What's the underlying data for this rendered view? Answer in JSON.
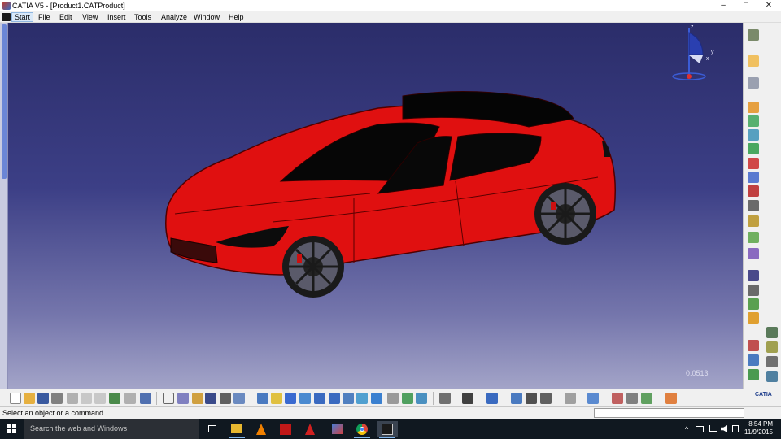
{
  "window": {
    "title": "CATIA V5 - [Product1.CATProduct]"
  },
  "window_controls": {
    "minimize": "–",
    "maximize": "□",
    "close": "✕"
  },
  "menu": {
    "items": [
      "Start",
      "File",
      "Edit",
      "View",
      "Insert",
      "Tools",
      "Analyze",
      "Window",
      "Help"
    ],
    "active": "Start"
  },
  "viewport": {
    "scale_readout": "0.0513",
    "compass_axes": {
      "z": "z",
      "x": "x",
      "y": "y"
    },
    "model_color": "#e01010"
  },
  "status": {
    "message": "Select an object or a command",
    "command_value": ""
  },
  "taskbar": {
    "search_placeholder": "Search the web and Windows",
    "apps": [
      "task-view",
      "file-explorer",
      "vlc",
      "solidworks",
      "autocad",
      "catia-launcher",
      "chrome",
      "catia-v5"
    ],
    "time": "8:54 PM",
    "date": "11/9/2015"
  },
  "toolbar": {
    "brand_label": "CATIA",
    "bottom_icons": [
      "new-icon",
      "open-icon",
      "save-icon",
      "print-icon",
      "cut-icon",
      "copy-icon",
      "paste-icon",
      "undo-icon",
      "redo-icon",
      "whats-this-icon",
      "formula-icon",
      "comment-icon",
      "catalog-icon",
      "knowledge-icon",
      "table-icon",
      "fly-mode-icon",
      "fit-all-icon",
      "pan-icon",
      "rotate-icon",
      "zoom-in-icon",
      "zoom-out-icon",
      "normal-view-icon",
      "iso-view-icon",
      "view-mode-icon",
      "hide-show-icon",
      "swap-space-icon",
      "shading-icon",
      "measure-icon",
      "capture-icon",
      "update-icon",
      "move-icon",
      "snap-icon",
      "constraint-icon",
      "manipulate-icon",
      "section-icon",
      "render-icon",
      "clash-icon",
      "compass-icon",
      "grid-icon"
    ],
    "right_icons": [
      "assembly-icon",
      "select-icon",
      "product-icon",
      "component-icon",
      "new-part-icon",
      "existing-component-icon",
      "replace-icon",
      "graph-tree-icon",
      "generate-numbering-icon",
      "bill-of-material-icon",
      "multi-instantiation-icon",
      "constraint-icon",
      "fix-icon",
      "coincidence-icon",
      "contact-icon",
      "offset-icon",
      "angle-icon",
      "fix-together-icon",
      "quick-constraint-icon",
      "flexible-icon",
      "change-constraint-icon",
      "reuse-pattern-icon",
      "explode-icon",
      "manipulation-icon",
      "snap-icon",
      "clash-icon",
      "sectioning-icon",
      "distance-icon"
    ]
  }
}
